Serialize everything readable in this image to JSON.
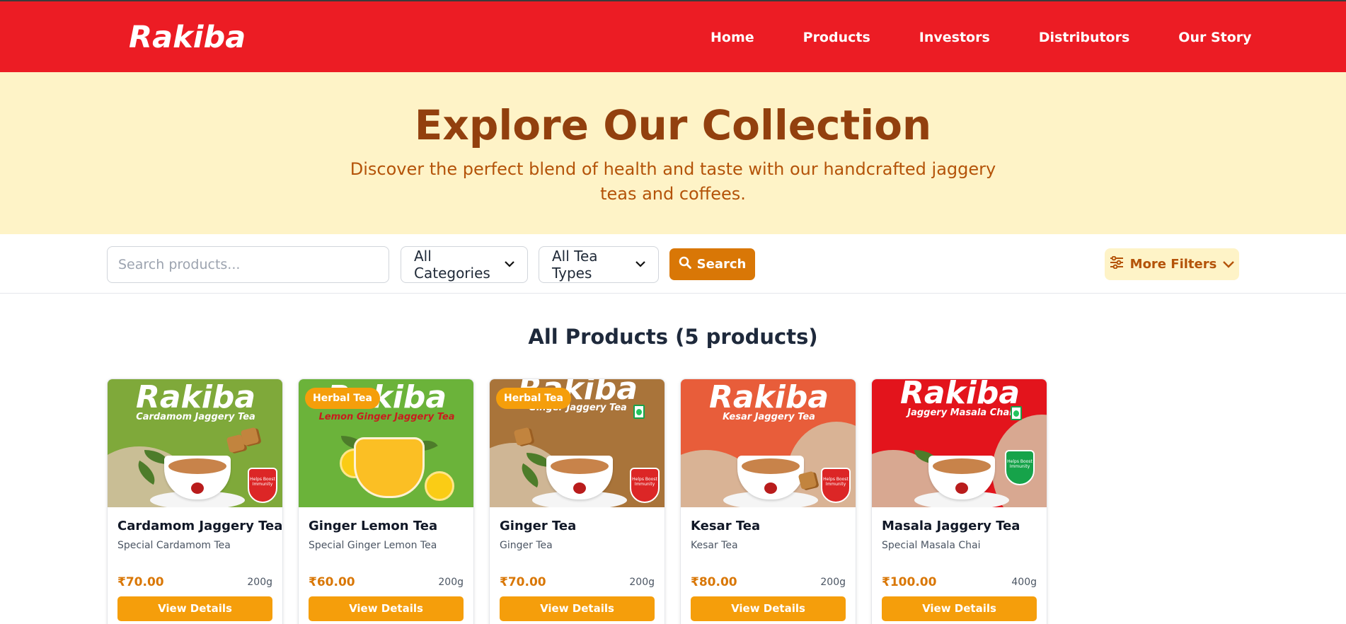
{
  "brand": {
    "logo_text": "Rakiba"
  },
  "nav": {
    "items": [
      {
        "label": "Home"
      },
      {
        "label": "Products"
      },
      {
        "label": "Investors"
      },
      {
        "label": "Distributors"
      },
      {
        "label": "Our Story"
      }
    ]
  },
  "hero": {
    "title": "Explore Our Collection",
    "subtitle": "Discover the perfect blend of health and taste with our handcrafted jaggery teas and coffees."
  },
  "filters": {
    "search_placeholder": "Search products...",
    "search_value": "",
    "category_selected": "All Categories",
    "tea_type_selected": "All Tea Types",
    "search_button": "Search",
    "more_filters_button": "More Filters"
  },
  "products_section": {
    "title": "All Products (5 products)"
  },
  "colors": {
    "brand_red": "#ec1c24",
    "accent_orange": "#f59e0b",
    "price_orange": "#d97706",
    "hero_bg": "#fef3c7",
    "hero_title": "#92400e"
  },
  "products": [
    {
      "name": "Cardamom Jaggery Tea",
      "subtitle": "Special Cardamom Tea",
      "price": "₹70.00",
      "weight": "200g",
      "badge": "",
      "button": "View Details",
      "image": {
        "brand": "Rakiba",
        "label": "Cardamom Jaggery Tea",
        "shield_text": "Helps Boost Immunity",
        "bg": "#7fa93a"
      }
    },
    {
      "name": "Ginger Lemon Tea",
      "subtitle": "Special Ginger Lemon Tea",
      "price": "₹60.00",
      "weight": "200g",
      "badge": "Herbal Tea",
      "button": "View Details",
      "image": {
        "brand": "Rakiba",
        "label": "Lemon Ginger Jaggery Tea",
        "shield_text": "",
        "bg": "#6bb33a"
      }
    },
    {
      "name": "Ginger Tea",
      "subtitle": "Ginger Tea",
      "price": "₹70.00",
      "weight": "200g",
      "badge": "Herbal Tea",
      "button": "View Details",
      "image": {
        "brand": "Rakiba",
        "label": "Ginger Jaggery Tea",
        "shield_text": "Helps Boost Immunity",
        "bg": "#a9743a"
      }
    },
    {
      "name": "Kesar Tea",
      "subtitle": "Kesar Tea",
      "price": "₹80.00",
      "weight": "200g",
      "badge": "",
      "button": "View Details",
      "image": {
        "brand": "Rakiba",
        "label": "Kesar Jaggery Tea",
        "shield_text": "Helps Boost Immunity",
        "bg": "#e85d3a"
      }
    },
    {
      "name": "Masala Jaggery Tea",
      "subtitle": "Special Masala Chai",
      "price": "₹100.00",
      "weight": "400g",
      "badge": "",
      "button": "View Details",
      "image": {
        "brand": "Rakiba",
        "label": "Jaggery Masala Chai",
        "shield_text": "Helps Boost Immunity",
        "bg": "#e3141c"
      }
    }
  ]
}
